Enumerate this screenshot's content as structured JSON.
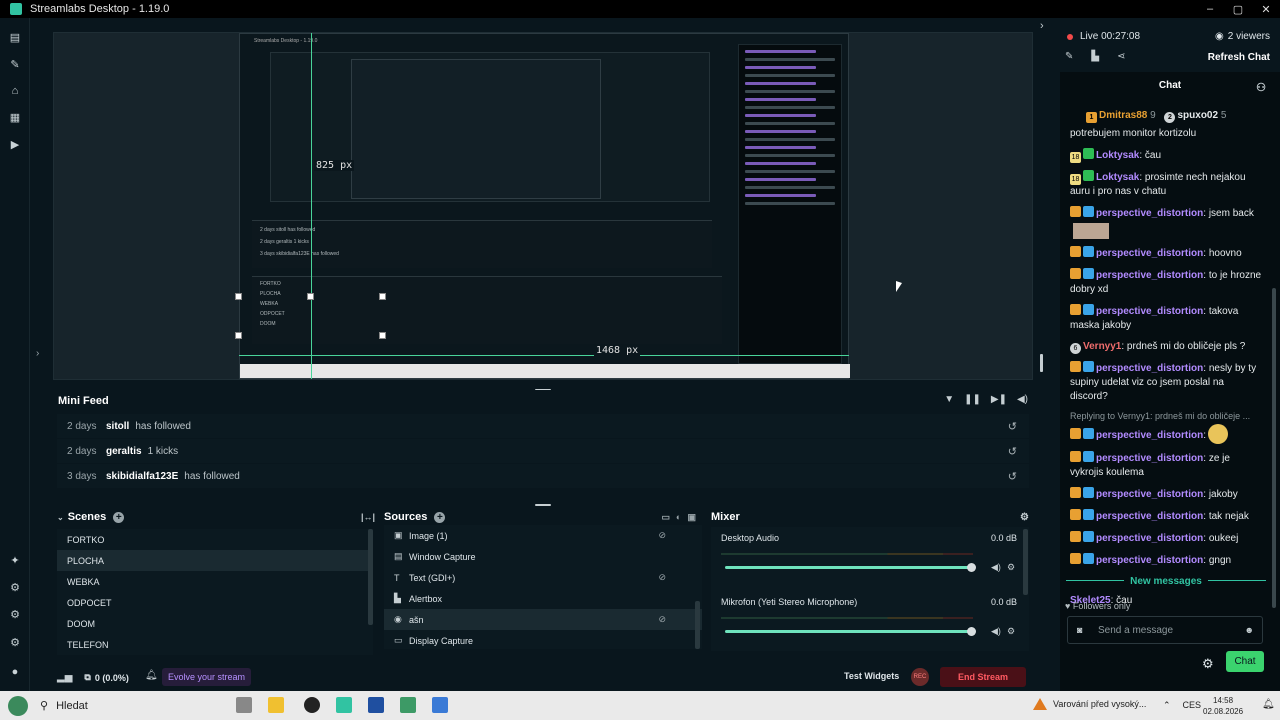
{
  "window": {
    "title": "Streamlabs Desktop - 1.19.0",
    "controls": [
      "–",
      "▢",
      "✕"
    ]
  },
  "leftnav": {
    "top_icons": [
      "editor-icon",
      "themes-icon",
      "store-icon",
      "apps-icon",
      "play-icon"
    ],
    "bottom_icons": [
      "highlighter-icon",
      "multistream-icon",
      "layout-icon",
      "settings-icon",
      "profile-icon"
    ]
  },
  "preview": {
    "nested_title": "Streamlabs Desktop - 1.19.0",
    "label_825": "825 px",
    "label_1468": "1468 px",
    "nested_minifeed": [
      "2 days  sitoll  has followed",
      "2 days  geraltis  1 kicks",
      "3 days  skibidialfa123E  has followed"
    ],
    "nested_scenes": [
      "FORTKO",
      "PLOCHA",
      "WEBKA",
      "ODPOCET",
      "DOOM",
      "TELEFON"
    ]
  },
  "minifeed": {
    "title": "Mini Feed",
    "rows": [
      {
        "age": "2 days",
        "name": "sitoll",
        "action": "has followed"
      },
      {
        "age": "2 days",
        "name": "geraltis",
        "action": "1 kicks"
      },
      {
        "age": "3 days",
        "name": "skibidialfa123E",
        "action": "has followed"
      }
    ]
  },
  "scenes": {
    "title": "Scenes",
    "items": [
      "FORTKO",
      "PLOCHA",
      "WEBKA",
      "ODPOCET",
      "DOOM",
      "TELEFON"
    ],
    "selected": "PLOCHA"
  },
  "sources": {
    "title": "Sources",
    "items": [
      {
        "label": "Image (1)",
        "icon": "image-icon",
        "hidden": true
      },
      {
        "label": "Window Capture",
        "icon": "window-icon",
        "hidden": false
      },
      {
        "label": "Text (GDI+)",
        "icon": "text-icon",
        "hidden": true
      },
      {
        "label": "Alertbox",
        "icon": "alert-icon",
        "hidden": false
      },
      {
        "label": "ašn",
        "icon": "webcam-icon",
        "hidden": true
      },
      {
        "label": "Display Capture",
        "icon": "monitor-icon",
        "hidden": false
      }
    ]
  },
  "mixer": {
    "title": "Mixer",
    "items": [
      {
        "name": "Desktop Audio",
        "db": "0.0 dB",
        "level": 1.0
      },
      {
        "name": "Mikrofon (Yeti Stereo Microphone)",
        "db": "0.0 dB",
        "level": 1.0
      }
    ]
  },
  "footer": {
    "perf": "0 (0.0%)",
    "evolve": "Evolve your stream",
    "test_widgets": "Test Widgets",
    "rec": "REC",
    "end_stream": "End Stream"
  },
  "right": {
    "live": "Live 00:27:08",
    "viewers": "2 viewers",
    "refresh": "Refresh Chat",
    "chat_title": "Chat",
    "top_bar": {
      "user1": "Dmitras88",
      "n1": "9",
      "user2": "spuxo02",
      "n2": "5"
    },
    "messages": [
      {
        "user": "",
        "text": "potrebujem monitor kortizolu",
        "color": "#e6eaec",
        "badges": []
      },
      {
        "user": "Loktysak",
        "text": ": čau",
        "color": "#b28bff",
        "badges": [
          "18",
          "green"
        ]
      },
      {
        "user": "Loktysak",
        "text": ": prosimte nech nejakou auru i pro nas v chatu",
        "color": "#b28bff",
        "badges": [
          "18",
          "green"
        ]
      },
      {
        "user": "perspective_distortion",
        "text": ": jsem back",
        "color": "#b28bff",
        "badges": [
          "crown",
          "sub"
        ],
        "emote": "image"
      },
      {
        "user": "perspective_distortion",
        "text": ": hoovno",
        "color": "#b28bff",
        "badges": [
          "crown",
          "sub"
        ]
      },
      {
        "user": "perspective_distortion",
        "text": ": to je hrozne dobry xd",
        "color": "#b28bff",
        "badges": [
          "crown",
          "sub"
        ]
      },
      {
        "user": "perspective_distortion",
        "text": ": takova maska jakoby",
        "color": "#b28bff",
        "badges": [
          "crown",
          "sub"
        ]
      },
      {
        "user": "Vernyy1",
        "text": ": prdneš mi do obličeje pls ?",
        "color": "#f06d6d",
        "badges": [
          "grey"
        ]
      },
      {
        "user": "perspective_distortion",
        "text": ": nesly by ty supiny udelat viz co jsem poslal na discord?",
        "color": "#b28bff",
        "badges": [
          "crown",
          "sub"
        ]
      },
      {
        "reply": "Replying to Vernyy1: prdneš mi do obličeje ..."
      },
      {
        "user": "perspective_distortion",
        "text": ":",
        "color": "#b28bff",
        "badges": [
          "crown",
          "sub"
        ],
        "emote": "face"
      },
      {
        "user": "perspective_distortion",
        "text": ": ze je vykrojis koulema",
        "color": "#b28bff",
        "badges": [
          "crown",
          "sub"
        ]
      },
      {
        "user": "perspective_distortion",
        "text": ": jakoby",
        "color": "#b28bff",
        "badges": [
          "crown",
          "sub"
        ]
      },
      {
        "user": "perspective_distortion",
        "text": ": tak nejak",
        "color": "#b28bff",
        "badges": [
          "crown",
          "sub"
        ]
      },
      {
        "user": "perspective_distortion",
        "text": ": oukeej",
        "color": "#b28bff",
        "badges": [
          "crown",
          "sub"
        ]
      },
      {
        "user": "perspective_distortion",
        "text": ": gngn",
        "color": "#b28bff",
        "badges": [
          "crown",
          "sub"
        ]
      },
      {
        "divider": "New messages"
      },
      {
        "user": "Skelet25",
        "text": ": čau",
        "color": "#b28bff",
        "badges": []
      }
    ],
    "followers_only": "Followers only",
    "input_placeholder": "Send a message",
    "chat_button": "Chat"
  },
  "taskbar": {
    "search": "Hledat",
    "warning": "Varování před vysoký...",
    "lang": "CES",
    "time": "14:58",
    "date": "02.08.2026"
  },
  "colors": {
    "accent": "#31c3a2",
    "purple": "#b28bff",
    "end_red": "#ff5a62",
    "chat_green": "#3bd36e"
  }
}
